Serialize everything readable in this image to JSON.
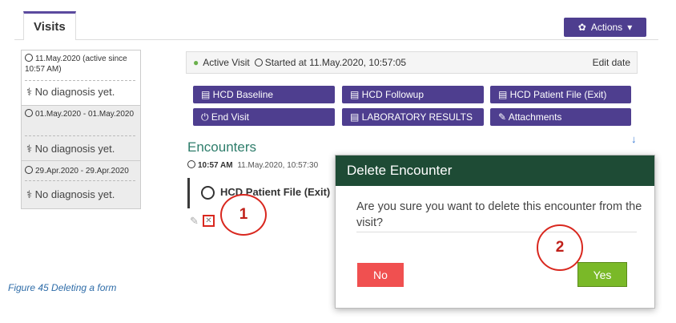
{
  "tab": {
    "label": "Visits"
  },
  "actions": {
    "label": "Actions",
    "icon": "gear-icon"
  },
  "visits": [
    {
      "date": "11.May.2020 (active since 10:57 AM)",
      "diagnosis": "No diagnosis yet."
    },
    {
      "date": "01.May.2020 - 01.May.2020",
      "diagnosis": "No diagnosis yet."
    },
    {
      "date": "29.Apr.2020 - 29.Apr.2020",
      "diagnosis": "No diagnosis yet."
    }
  ],
  "active_visit": {
    "status": "Active Visit",
    "started": "Started at 11.May.2020, 10:57:05",
    "edit": "Edit date"
  },
  "buttons": [
    "HCD Baseline",
    "HCD Followup",
    "HCD Patient File (Exit)",
    "End Visit",
    "LABORATORY RESULTS",
    "Attachments"
  ],
  "encounters": {
    "title": "Encounters",
    "time": "10:57 AM",
    "date": "11.May.2020, 10:57:30",
    "form": "HCD Patient File (Exit)"
  },
  "markers": [
    "1",
    "2"
  ],
  "dialog": {
    "title": "Delete Encounter",
    "message": "Are you sure you want to delete this encounter from the visit?",
    "no": "No",
    "yes": "Yes"
  },
  "caption": "Figure 45 Deleting a form"
}
